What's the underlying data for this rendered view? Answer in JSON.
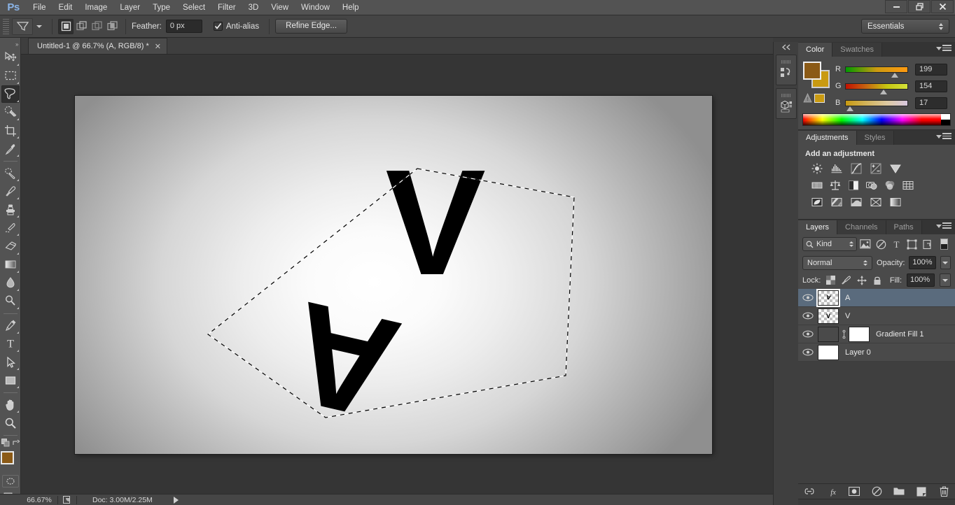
{
  "app": {
    "name": "Ps",
    "logo_color": "#8ab4e8"
  },
  "menubar": {
    "items": [
      "File",
      "Edit",
      "Image",
      "Layer",
      "Type",
      "Select",
      "Filter",
      "3D",
      "View",
      "Window",
      "Help"
    ]
  },
  "window_controls": {
    "minimize": "–",
    "restore": "❐",
    "close": "✕"
  },
  "options_bar": {
    "tool": "polygonal-lasso",
    "selection_modes": [
      "new-selection",
      "add-to-selection",
      "subtract-from-selection",
      "intersect-with-selection"
    ],
    "active_selection_mode": "new-selection",
    "feather_label": "Feather:",
    "feather_value": "0 px",
    "antialias_label": "Anti-alias",
    "antialias_checked": true,
    "refine_edge_label": "Refine Edge...",
    "workspace": "Essentials"
  },
  "toolbar": {
    "tools_top": [
      {
        "name": "move-tool",
        "has_flyout": true
      },
      {
        "name": "rectangular-marquee-tool",
        "has_flyout": true
      },
      {
        "name": "lasso-tool",
        "has_flyout": true,
        "active": true
      },
      {
        "name": "quick-selection-tool",
        "has_flyout": true
      },
      {
        "name": "crop-tool",
        "has_flyout": true
      },
      {
        "name": "eyedropper-tool",
        "has_flyout": true
      }
    ],
    "tools_mid": [
      {
        "name": "spot-healing-brush-tool",
        "has_flyout": true
      },
      {
        "name": "brush-tool",
        "has_flyout": true
      },
      {
        "name": "clone-stamp-tool",
        "has_flyout": true
      },
      {
        "name": "history-brush-tool",
        "has_flyout": true
      },
      {
        "name": "eraser-tool",
        "has_flyout": true
      },
      {
        "name": "gradient-tool",
        "has_flyout": true
      },
      {
        "name": "blur-tool",
        "has_flyout": true
      },
      {
        "name": "dodge-tool",
        "has_flyout": true
      }
    ],
    "tools_bottom": [
      {
        "name": "pen-tool",
        "has_flyout": true
      },
      {
        "name": "horizontal-type-tool",
        "has_flyout": true
      },
      {
        "name": "path-selection-tool",
        "has_flyout": true
      },
      {
        "name": "rectangle-tool",
        "has_flyout": true
      }
    ],
    "tools_nav": [
      {
        "name": "hand-tool",
        "has_flyout": true
      },
      {
        "name": "zoom-tool",
        "has_flyout": false
      }
    ],
    "foreground_color": "#8B5A16",
    "background_color": "#C99A11",
    "quick_mask": "edit-in-quick-mask-mode",
    "screen_mode": "change-screen-mode"
  },
  "document": {
    "tab_title": "Untitled-1 @ 66.7% (A, RGB/8) *",
    "close_glyph": "✕",
    "artwork_text": "AV"
  },
  "status_bar": {
    "zoom": "66.67%",
    "doc_info": "Doc: 3.00M/2.25M"
  },
  "mini_dock": {
    "collapse_glyph": "«",
    "items": [
      {
        "name": "history-panel-icon"
      },
      {
        "name": "3d-panel-icon"
      }
    ]
  },
  "color_panel": {
    "tabs": [
      {
        "label": "Color",
        "active": true
      },
      {
        "label": "Swatches",
        "active": false
      }
    ],
    "foreground_color": "#8B5A16",
    "background_color": "#C99A11",
    "channels": [
      {
        "label": "R",
        "value": "199",
        "pct": 78
      },
      {
        "label": "G",
        "value": "154",
        "pct": 60
      },
      {
        "label": "B",
        "value": "17",
        "pct": 7
      }
    ],
    "out_of_gamut_label": "A"
  },
  "adjustments_panel": {
    "tabs": [
      {
        "label": "Adjustments",
        "active": true
      },
      {
        "label": "Styles",
        "active": false
      }
    ],
    "title": "Add an adjustment",
    "rows": [
      [
        "brightness-contrast-icon",
        "levels-icon",
        "curves-icon",
        "exposure-icon",
        "vibrance-icon"
      ],
      [
        "hue-saturation-icon",
        "color-balance-icon",
        "black-white-icon",
        "photo-filter-icon",
        "channel-mixer-icon",
        "color-lookup-icon"
      ],
      [
        "invert-icon",
        "posterize-icon",
        "threshold-icon",
        "selective-color-icon",
        "gradient-map-icon"
      ]
    ]
  },
  "layers_panel": {
    "tabs": [
      {
        "label": "Layers",
        "active": true
      },
      {
        "label": "Channels",
        "active": false
      },
      {
        "label": "Paths",
        "active": false
      }
    ],
    "filter": {
      "kind_label": "Kind",
      "filter_icons": [
        "filter-pixel-layers-icon",
        "filter-adjustment-layers-icon",
        "filter-type-layers-icon",
        "filter-shape-layers-icon",
        "filter-smart-objects-icon"
      ],
      "toggle_name": "filter-toggle-switch"
    },
    "blend_mode": "Normal",
    "opacity_label": "Opacity:",
    "opacity_value": "100%",
    "lock_label": "Lock:",
    "lock_icons": [
      "lock-transparent-pixels-icon",
      "lock-image-pixels-icon",
      "lock-position-icon",
      "lock-all-icon"
    ],
    "fill_label": "Fill:",
    "fill_value": "100%",
    "layers": [
      {
        "name": "A",
        "type": "pixel",
        "visible": true,
        "selected": true
      },
      {
        "name": "V",
        "type": "pixel",
        "visible": true,
        "selected": false
      },
      {
        "name": "Gradient Fill 1",
        "type": "gradient-fill",
        "visible": true,
        "selected": false,
        "has_mask": true
      },
      {
        "name": "Layer 0",
        "type": "pixel",
        "visible": true,
        "selected": false
      }
    ],
    "footer_icons": [
      "link-layers-icon",
      "add-layer-style-icon",
      "add-layer-mask-icon",
      "new-adjustment-layer-icon",
      "new-group-icon",
      "new-layer-icon",
      "delete-layer-icon"
    ]
  }
}
